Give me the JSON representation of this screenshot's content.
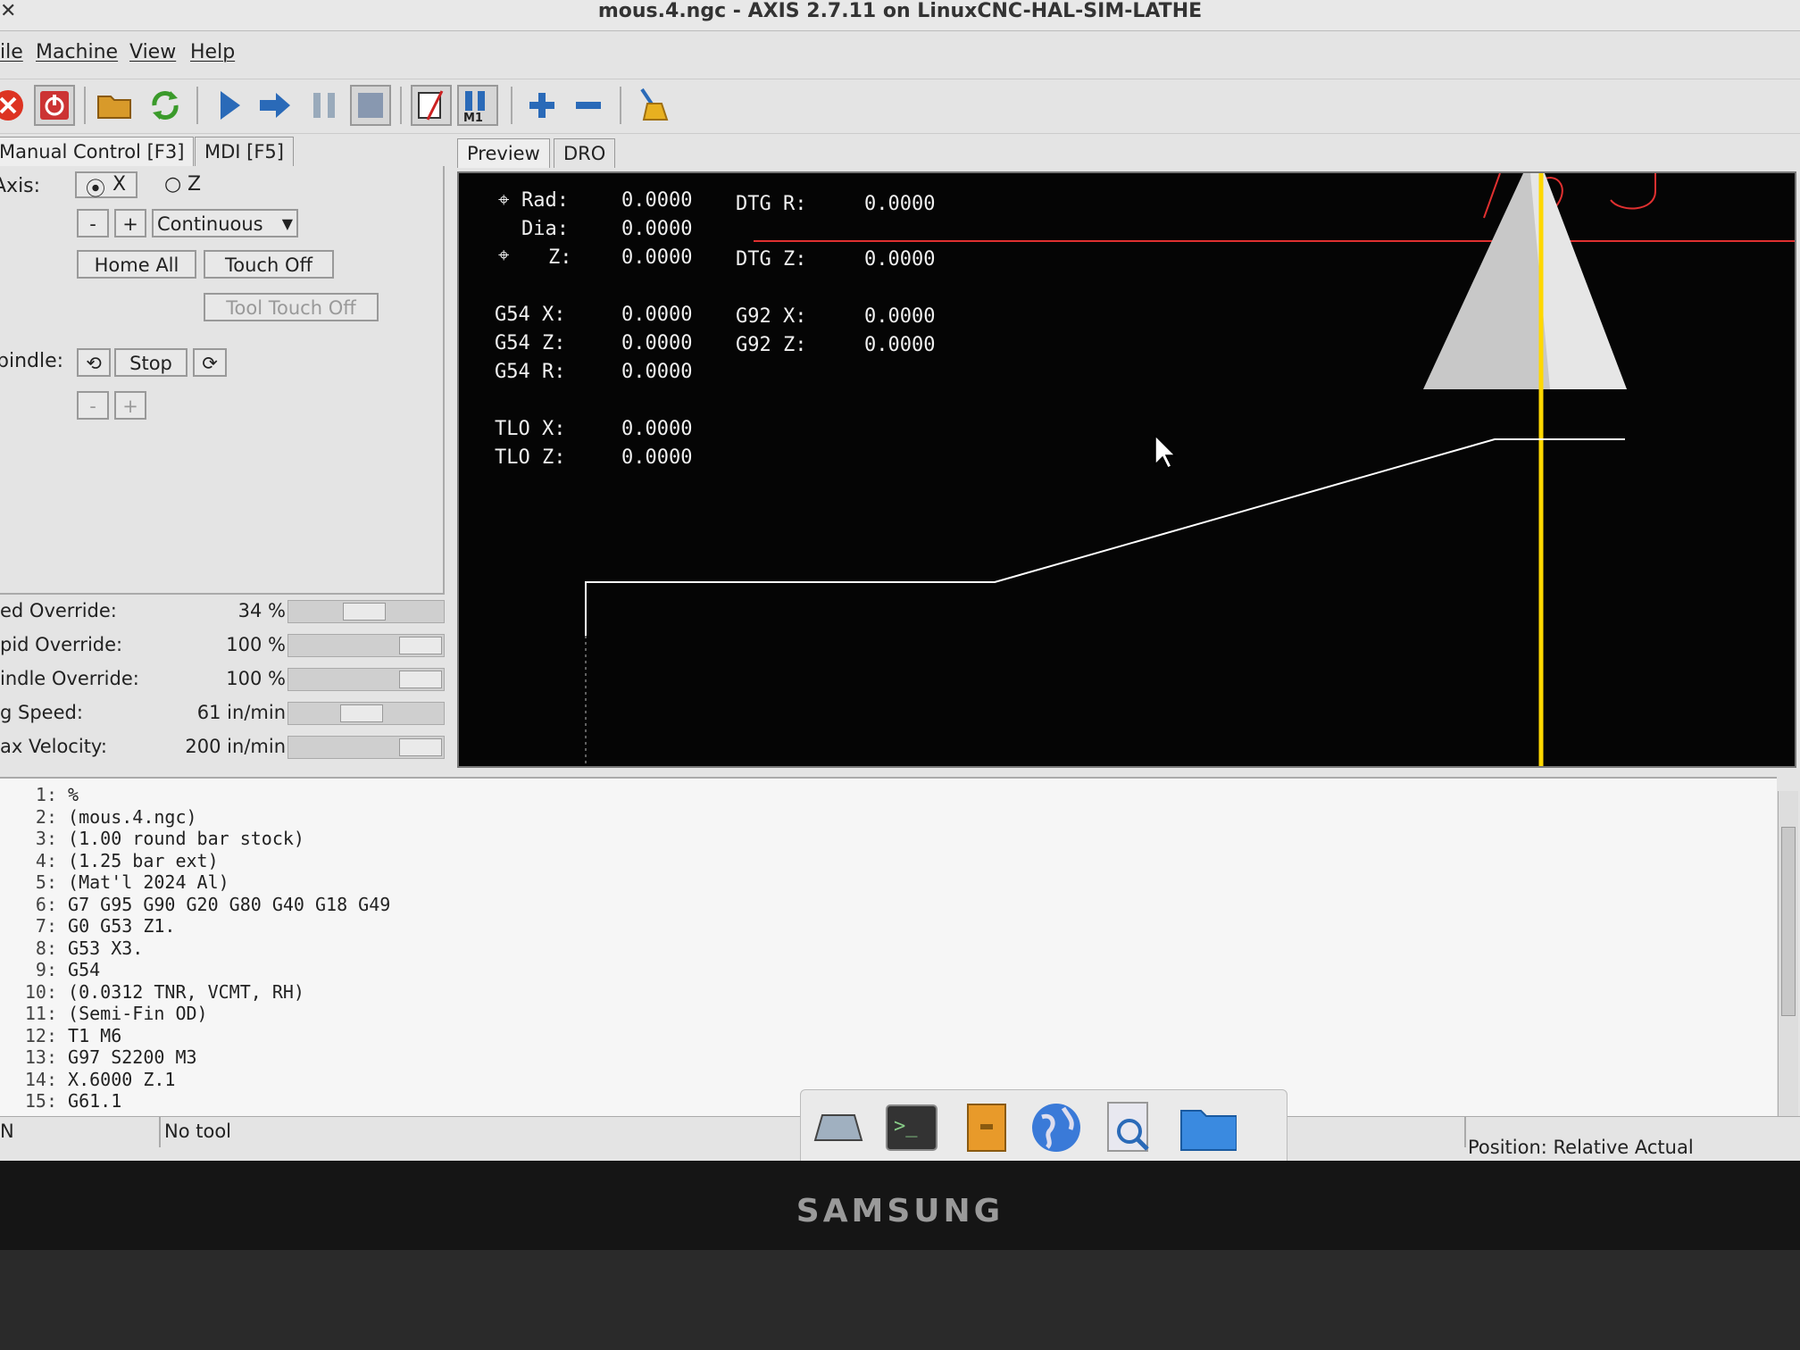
{
  "window": {
    "title": "mous.4.ngc - AXIS 2.7.11 on LinuxCNC-HAL-SIM-LATHE"
  },
  "menu": [
    "ile",
    "Machine",
    "View",
    "Help"
  ],
  "toolbar": [
    {
      "icon": "estop-icon"
    },
    {
      "icon": "power-icon"
    },
    {
      "icon": "open-folder-icon"
    },
    {
      "icon": "reload-icon"
    },
    {
      "icon": "run-icon"
    },
    {
      "icon": "step-icon"
    },
    {
      "icon": "pause-icon"
    },
    {
      "icon": "stop-icon"
    },
    {
      "icon": "block-delete-icon"
    },
    {
      "icon": "optional-stop-icon",
      "label": "M1"
    },
    {
      "icon": "zoom-in-icon"
    },
    {
      "icon": "zoom-out-icon"
    },
    {
      "icon": "clear-plot-icon"
    }
  ],
  "tabs": {
    "manual": "Manual Control [F3]",
    "mdi": "MDI [F5]"
  },
  "manual": {
    "axis_label": "Axis:",
    "axis_x": "X",
    "axis_z": "Z",
    "jog_minus": "-",
    "jog_plus": "+",
    "jog_mode": "Continuous",
    "home_all": "Home All",
    "touch_off": "Touch Off",
    "tool_touch_off": "Tool Touch Off",
    "spindle_label": "pindle:",
    "spindle_stop": "Stop",
    "spindle_minus": "-",
    "spindle_plus": "+"
  },
  "overrides": [
    {
      "name": "ed Override:",
      "value": "34 %",
      "fraction": 0.34
    },
    {
      "name": "pid Override:",
      "value": "100 %",
      "fraction": 1.0
    },
    {
      "name": "indle Override:",
      "value": "100 %",
      "fraction": 1.0
    },
    {
      "name": "g Speed:",
      "value": "61 in/min",
      "fraction": 0.3
    },
    {
      "name": "ax Velocity:",
      "value": "200 in/min",
      "fraction": 1.0
    }
  ],
  "preview_tabs": {
    "preview": "Preview",
    "dro": "DRO"
  },
  "dro": {
    "rad_label": "Rad:",
    "rad": "0.0000",
    "dtg_r_label": "DTG R:",
    "dtg_r": "0.0000",
    "dia_label": "Dia:",
    "dia": "0.0000",
    "z_label": "Z:",
    "z": "0.0000",
    "dtg_z_label": "DTG Z:",
    "dtg_z": "0.0000",
    "g54x_label": "G54 X:",
    "g54x": "0.0000",
    "g92x_label": "G92 X:",
    "g92x": "0.0000",
    "g54z_label": "G54 Z:",
    "g54z": "0.0000",
    "g92z_label": "G92 Z:",
    "g92z": "0.0000",
    "g54r_label": "G54 R:",
    "g54r": "0.0000",
    "tlox_label": "TLO X:",
    "tlox": "0.0000",
    "tloz_label": "TLO Z:",
    "tloz": "0.0000"
  },
  "gcode": [
    {
      "n": "1:",
      "text": "%"
    },
    {
      "n": "2:",
      "text": "(mous.4.ngc)"
    },
    {
      "n": "3:",
      "text": "(1.00 round bar stock)"
    },
    {
      "n": "4:",
      "text": "(1.25 bar ext)"
    },
    {
      "n": "5:",
      "text": "(Mat'l 2024 Al)"
    },
    {
      "n": "6:",
      "text": "G7 G95 G90 G20 G80 G40 G18 G49"
    },
    {
      "n": "7:",
      "text": "G0 G53 Z1."
    },
    {
      "n": "8:",
      "text": "G53 X3."
    },
    {
      "n": "9:",
      "text": "G54"
    },
    {
      "n": "10:",
      "text": "(0.0312 TNR, VCMT, RH)"
    },
    {
      "n": "11:",
      "text": "(Semi-Fin OD)"
    },
    {
      "n": "12:",
      "text": "T1 M6"
    },
    {
      "n": "13:",
      "text": "G97 S2200 M3"
    },
    {
      "n": "14:",
      "text": "X.6000 Z.1"
    },
    {
      "n": "15:",
      "text": "G61.1"
    }
  ],
  "status": {
    "left": "N",
    "tool": "No tool",
    "position": "Position: Relative Actual"
  },
  "dock": [
    "window-manager-icon",
    "terminal-icon",
    "file-cabinet-icon",
    "globe-icon",
    "search-icon",
    "folder-icon"
  ],
  "bezel": {
    "brand": "SAMSUNG"
  },
  "colors": {
    "preview_bg": "#050505",
    "toolpath": "#ffffff",
    "tool_line": "#ffd800",
    "limit_line": "#e03030"
  }
}
